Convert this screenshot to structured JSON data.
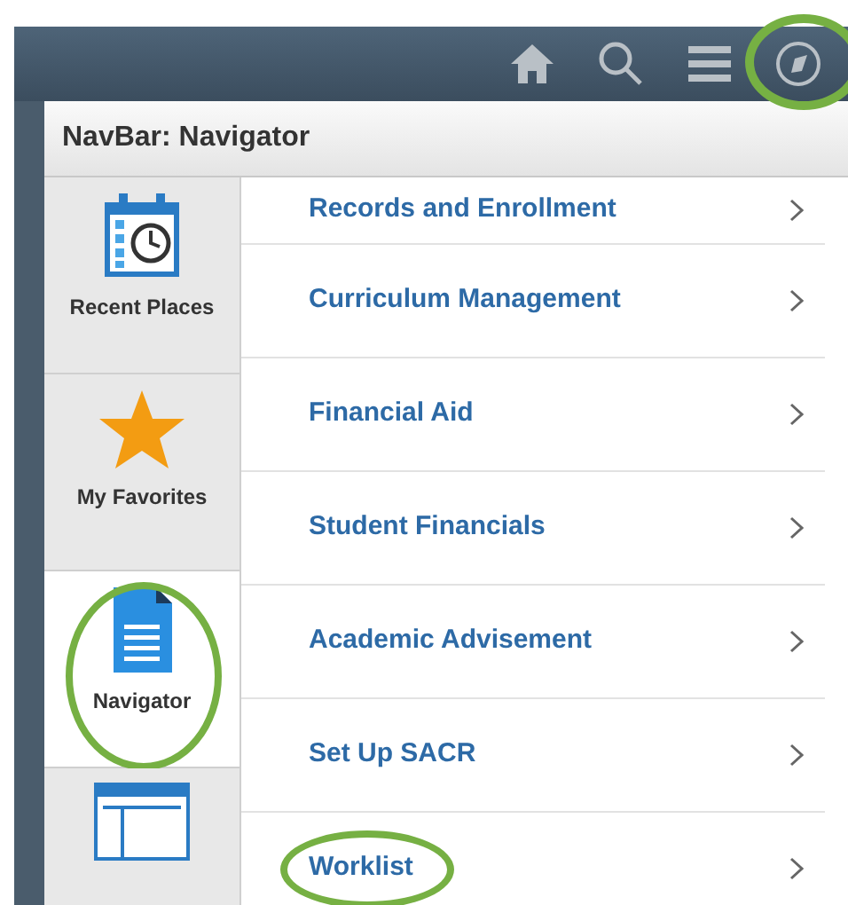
{
  "navbar": {
    "buttons": [
      {
        "kind": "home",
        "highlighted": false
      },
      {
        "kind": "search",
        "highlighted": false
      },
      {
        "kind": "menu",
        "highlighted": false
      },
      {
        "kind": "navigator",
        "highlighted": true
      }
    ]
  },
  "panel": {
    "title": "NavBar: Navigator",
    "tiles": [
      {
        "kind": "recent",
        "label": "Recent Places",
        "selected": false,
        "highlighted": false
      },
      {
        "kind": "favorites",
        "label": "My Favorites",
        "selected": false,
        "highlighted": false
      },
      {
        "kind": "navigator",
        "label": "Navigator",
        "selected": true,
        "highlighted": true
      },
      {
        "kind": "classic",
        "selected": false,
        "highlighted": false
      }
    ],
    "items": [
      {
        "label": "Records and Enrollment",
        "highlighted": false
      },
      {
        "label": "Curriculum Management",
        "highlighted": false
      },
      {
        "label": "Financial Aid",
        "highlighted": false
      },
      {
        "label": "Student Financials",
        "highlighted": false
      },
      {
        "label": "Academic Advisement",
        "highlighted": false
      },
      {
        "label": "Set Up SACR",
        "highlighted": false
      },
      {
        "label": "Worklist",
        "highlighted": true
      }
    ]
  }
}
